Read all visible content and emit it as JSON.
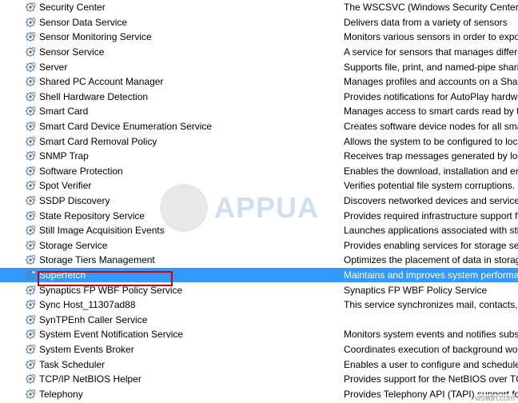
{
  "services": [
    {
      "name": "Security Center",
      "desc": "The WSCSVC (Windows Security Center) servic"
    },
    {
      "name": "Sensor Data Service",
      "desc": "Delivers data from a variety of sensors"
    },
    {
      "name": "Sensor Monitoring Service",
      "desc": "Monitors various sensors in order to expose da"
    },
    {
      "name": "Sensor Service",
      "desc": "A service for sensors that manages different se"
    },
    {
      "name": "Server",
      "desc": "Supports file, print, and named-pipe sharing o"
    },
    {
      "name": "Shared PC Account Manager",
      "desc": "Manages profiles and accounts on a SharedPC"
    },
    {
      "name": "Shell Hardware Detection",
      "desc": "Provides notifications for AutoPlay hardware e"
    },
    {
      "name": "Smart Card",
      "desc": "Manages access to smart cards read by this co"
    },
    {
      "name": "Smart Card Device Enumeration Service",
      "desc": "Creates software device nodes for all smart ca"
    },
    {
      "name": "Smart Card Removal Policy",
      "desc": "Allows the system to be configured to lock the"
    },
    {
      "name": "SNMP Trap",
      "desc": "Receives trap messages generated by local or"
    },
    {
      "name": "Software Protection",
      "desc": "Enables the download, installation and enforc"
    },
    {
      "name": "Spot Verifier",
      "desc": "Verifies potential file system corruptions."
    },
    {
      "name": "SSDP Discovery",
      "desc": "Discovers networked devices and services that"
    },
    {
      "name": "State Repository Service",
      "desc": "Provides required infrastructure support for th"
    },
    {
      "name": "Still Image Acquisition Events",
      "desc": "Launches applications associated with still ima"
    },
    {
      "name": "Storage Service",
      "desc": "Provides enabling services for storage settings"
    },
    {
      "name": "Storage Tiers Management",
      "desc": "Optimizes the placement of data in storage tie"
    },
    {
      "name": "Superfetch",
      "desc": "Maintains and improves system performance o",
      "selected": true
    },
    {
      "name": "Synaptics FP WBF Policy Service",
      "desc": "Synaptics FP WBF Policy Service"
    },
    {
      "name": "Sync Host_11307ad88",
      "desc": "This service synchronizes mail, contacts, calen"
    },
    {
      "name": "SynTPEnh Caller Service",
      "desc": ""
    },
    {
      "name": "System Event Notification Service",
      "desc": "Monitors system events and notifies subscribe"
    },
    {
      "name": "System Events Broker",
      "desc": "Coordinates execution of background work fo"
    },
    {
      "name": "Task Scheduler",
      "desc": "Enables a user to configure and schedule auto"
    },
    {
      "name": "TCP/IP NetBIOS Helper",
      "desc": "Provides support for the NetBIOS over TCP/IP"
    },
    {
      "name": "Telephony",
      "desc": "Provides Telephony API (TAPI) support for pro"
    }
  ],
  "watermark": "APPUA",
  "source": "wsxdn.com"
}
